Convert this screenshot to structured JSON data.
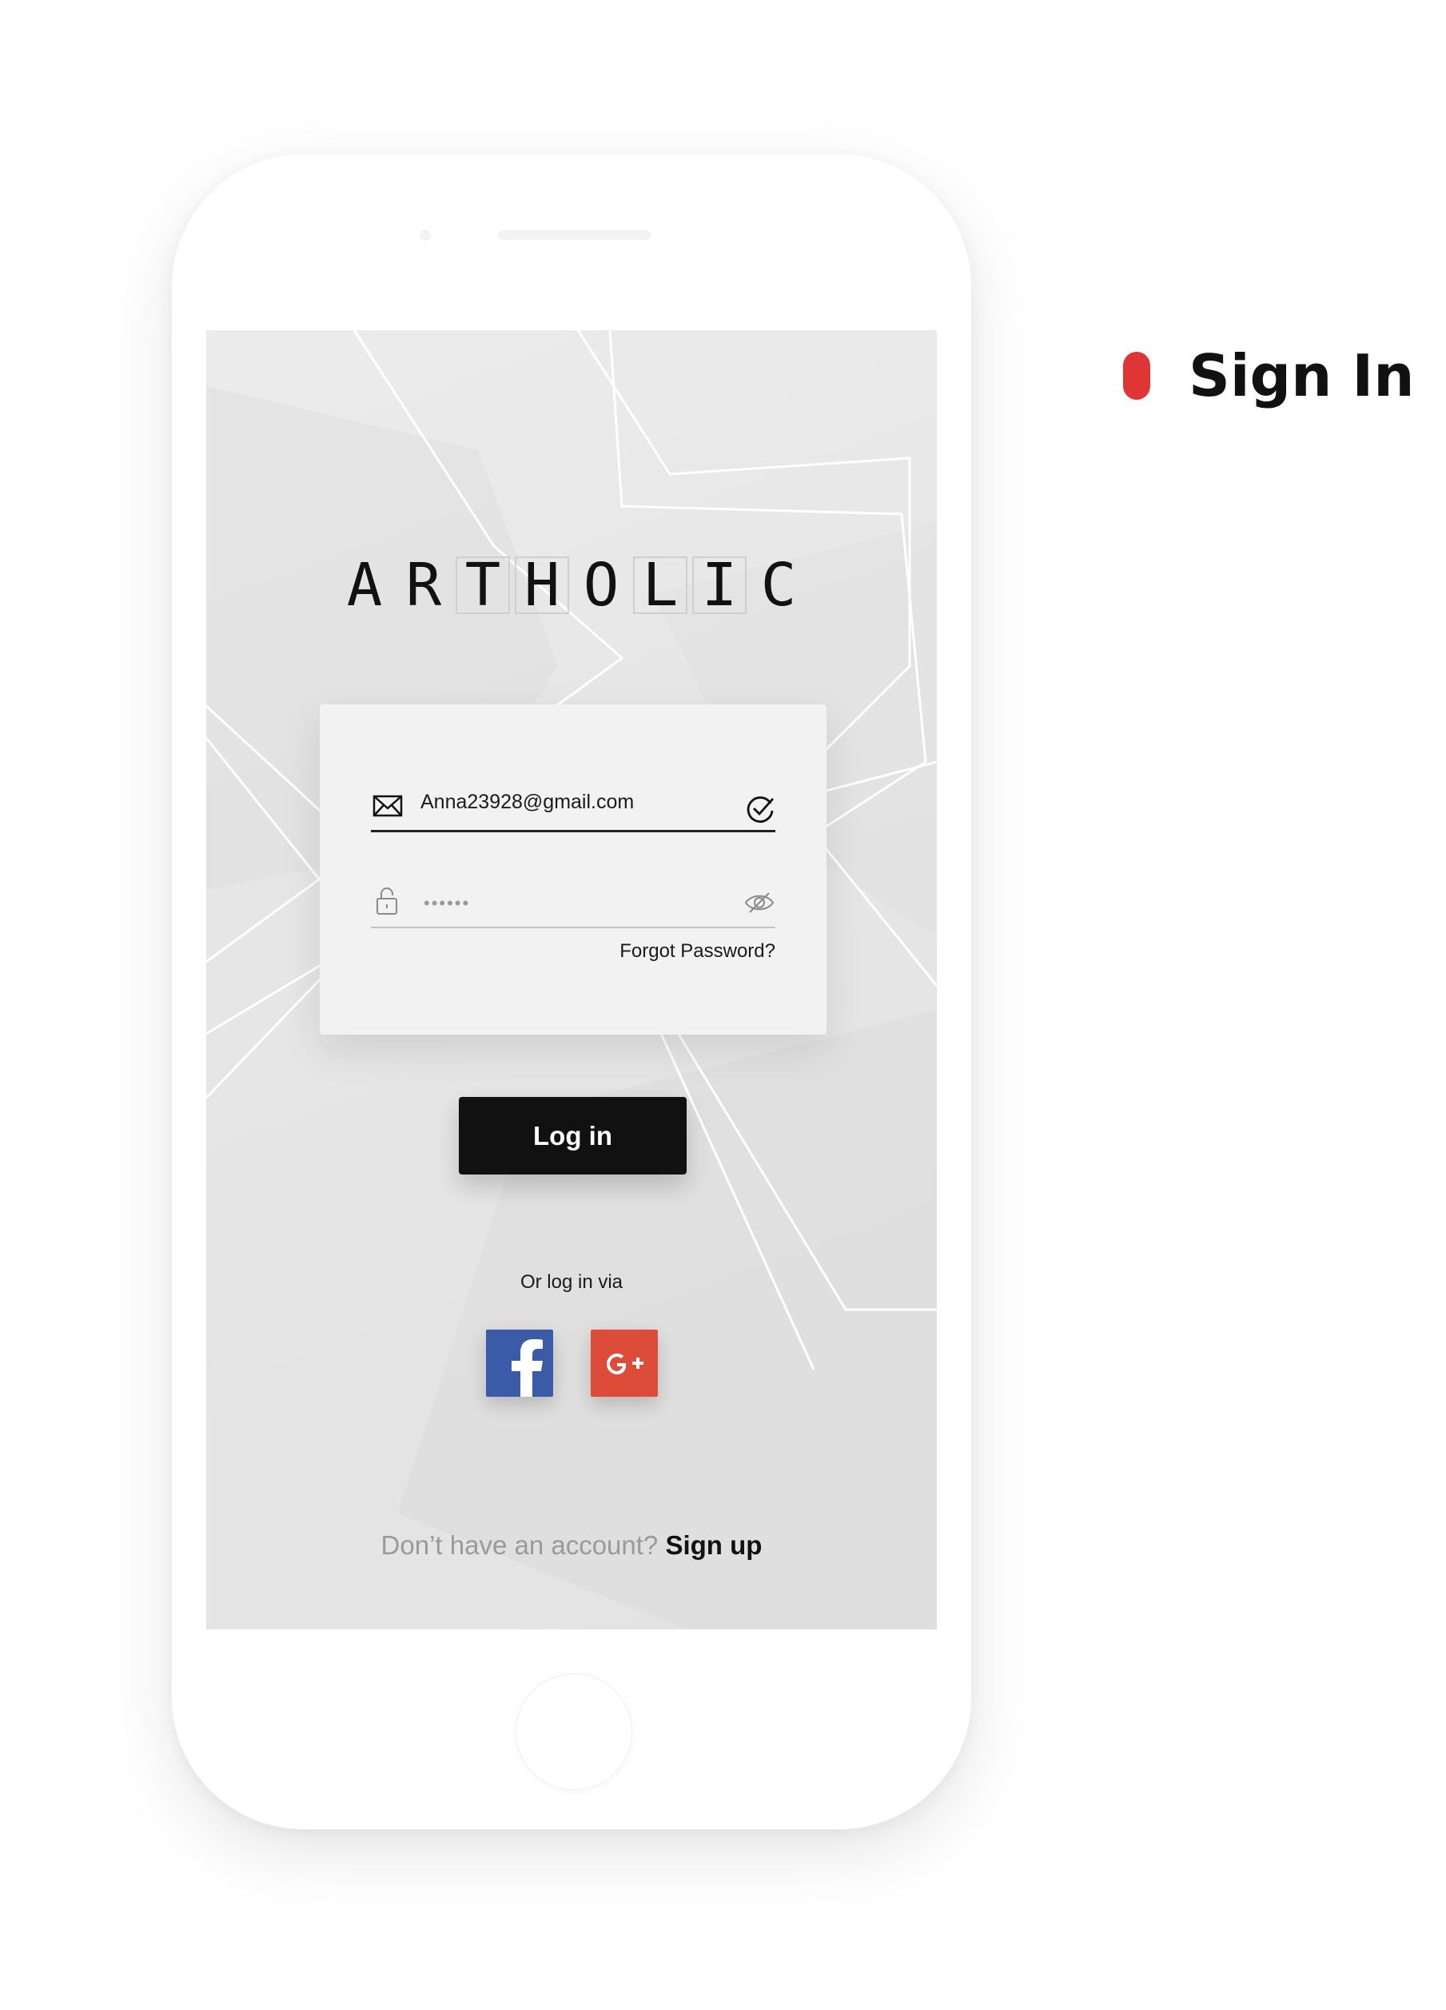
{
  "colors": {
    "accent": "#e03535",
    "button": "#111111",
    "facebook": "#3b5ba9",
    "google": "#dd4b39",
    "muted_text": "#9a9a9a"
  },
  "section": {
    "title": "Sign In"
  },
  "app": {
    "logo_letters": [
      "A",
      "R",
      "T",
      "H",
      "O",
      "L",
      "I",
      "C"
    ]
  },
  "form": {
    "email_value": "Anna23928@gmail.com",
    "email_icon": "envelope-icon",
    "email_status_icon": "check-circle-icon",
    "password_value": "••••••",
    "password_icon": "lock-icon",
    "password_toggle_icon": "eye-slash-icon",
    "forgot_label": "Forgot Password?"
  },
  "actions": {
    "login_label": "Log in",
    "alt_login_label": "Or log in via",
    "social": [
      "facebook-icon",
      "google-plus-icon"
    ]
  },
  "footer": {
    "prompt": "Don’t have an account?",
    "signup_label": "Sign up"
  }
}
